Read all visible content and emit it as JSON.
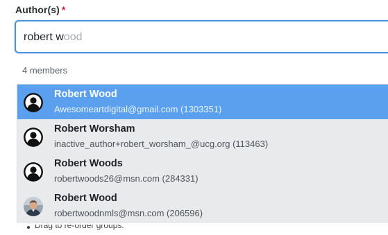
{
  "field": {
    "label": "Author(s)",
    "required_marker": "*"
  },
  "input": {
    "typed": "robert w",
    "suggestion_rest": "ood"
  },
  "dropdown": {
    "count_label": "4 members",
    "results": [
      {
        "name_match": "Robert W",
        "name_rest": "ood",
        "meta": "Awesomeartdigital@gmail.com (1303351)",
        "avatar": "default-user-icon",
        "highlighted": true
      },
      {
        "name_match": "Robert W",
        "name_rest": "orsham",
        "meta": "inactive_author+robert_worsham_@ucg.org (113463)",
        "avatar": "default-user-icon",
        "highlighted": false
      },
      {
        "name_match": "Robert W",
        "name_rest": "oods",
        "meta": "robertwoods26@msn.com (284331)",
        "avatar": "default-user-icon",
        "highlighted": false
      },
      {
        "name_match": "Robert W",
        "name_rest": "ood",
        "meta": "robertwoodnmls@msn.com (206596)",
        "avatar": "profile-photo",
        "highlighted": false
      }
    ]
  },
  "helper": {
    "text": "Drag to re-order groups."
  },
  "colors": {
    "accent": "#4a90e2",
    "highlight": "#5aa0ee",
    "required": "#d11a2a"
  }
}
